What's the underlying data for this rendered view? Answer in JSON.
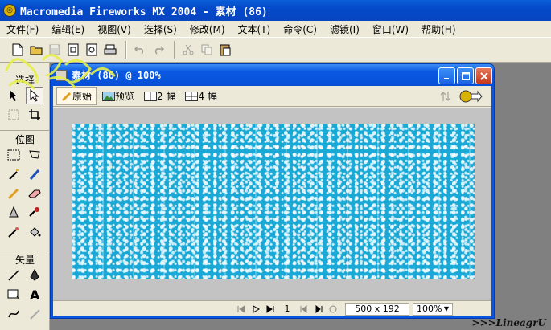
{
  "app": {
    "title": "Macromedia Fireworks MX 2004 - 素材 (86)"
  },
  "menu": [
    "文件(F)",
    "编辑(E)",
    "视图(V)",
    "选择(S)",
    "修改(M)",
    "文本(T)",
    "命令(C)",
    "滤镜(I)",
    "窗口(W)",
    "帮助(H)"
  ],
  "toolbar_icons": [
    "new-file-icon",
    "open-folder-icon",
    "save-icon",
    "import-icon",
    "export-icon",
    "print-icon",
    "undo-icon",
    "redo-icon",
    "cut-icon",
    "copy-icon",
    "paste-icon"
  ],
  "tools": {
    "select_label": "选择",
    "bitmap_label": "位图",
    "vector_label": "矢量",
    "select_tools": [
      "pointer-tool-icon",
      "subselect-tool-icon",
      "scale-tool-icon",
      "crop-tool-icon"
    ],
    "bitmap_tools": [
      "marquee-tool-icon",
      "lasso-tool-icon",
      "magic-wand-tool-icon",
      "brush-tool-icon",
      "pencil-tool-icon",
      "eraser-tool-icon",
      "blur-tool-icon",
      "rubber-stamp-tool-icon",
      "eyedropper-tool-icon",
      "paint-bucket-tool-icon"
    ],
    "vector_tools": [
      "line-tool-icon",
      "pen-tool-icon",
      "rectangle-tool-icon",
      "text-tool-icon",
      "freeform-tool-icon",
      "knife-tool-icon"
    ]
  },
  "document": {
    "title": "素材 (86) @ 100%",
    "tabs": {
      "original": "原始",
      "preview": "预览",
      "two_up": "2 幅",
      "four_up": "4 幅"
    },
    "frame_number": "1",
    "canvas_size": "500 x 192",
    "zoom": "100%"
  },
  "colors": {
    "titlebar_blue": "#0650d8",
    "chrome": "#ece9d8",
    "canvas_pattern": "#1aa9d6"
  },
  "watermark": ">>>LineagrU"
}
